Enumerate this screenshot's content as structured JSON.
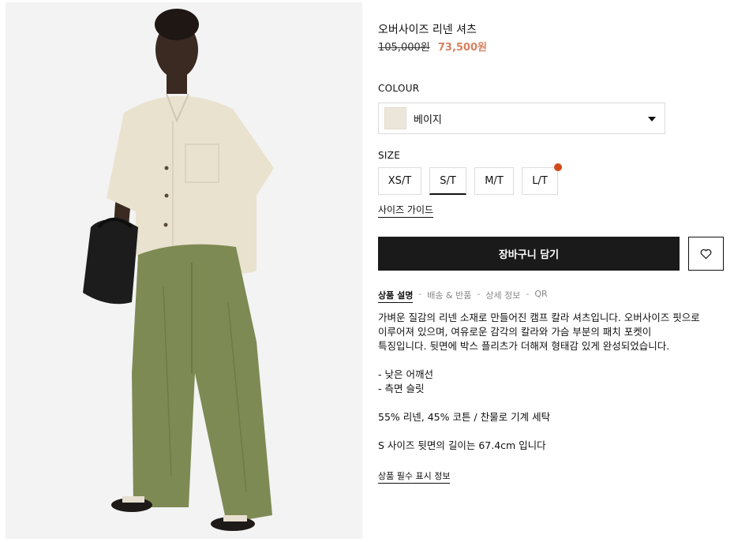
{
  "product": {
    "title": "오버사이즈 리넨 셔츠",
    "price_original": "105,000원",
    "price_sale": "73,500원"
  },
  "colour": {
    "label": "COLOUR",
    "selected": "베이지",
    "swatch_color": "#ece6da"
  },
  "size": {
    "label": "SIZE",
    "options": [
      "XS/T",
      "S/T",
      "M/T",
      "L/T"
    ],
    "selected": "S/T",
    "guide_label": "사이즈 가이드"
  },
  "actions": {
    "add_to_cart": "장바구니 담기",
    "wishlist_icon": "heart-icon"
  },
  "tabs": [
    "상품 설명",
    "배송 & 반품",
    "상세 정보",
    "QR"
  ],
  "tab_separator": "-",
  "description": {
    "lines": [
      "가벼운 질감의 리넨 소재로 만들어진 캠프 칼라 셔츠입니다. 오버사이즈 핏으로",
      "이루어져 있으며, 여유로운 감각의 칼라와 가슴 부분의 패치 포켓이",
      "특징입니다. 뒷면에 박스 플리츠가 더해져 형태감 있게 완성되었습니다."
    ],
    "features": [
      "- 낮은 어깨선",
      "- 측면 슬릿"
    ],
    "composition": "55% 리넨, 45% 코튼 / 찬물로 기계 세탁",
    "measurement": "S 사이즈 뒷면의 길이는 67.4cm 입니다"
  },
  "notice_link": "상품 필수 표시 정보",
  "colors": {
    "sale_price": "#d9805e",
    "cart_button": "#1a1a1a",
    "size_alert_dot": "#d04a1c"
  }
}
